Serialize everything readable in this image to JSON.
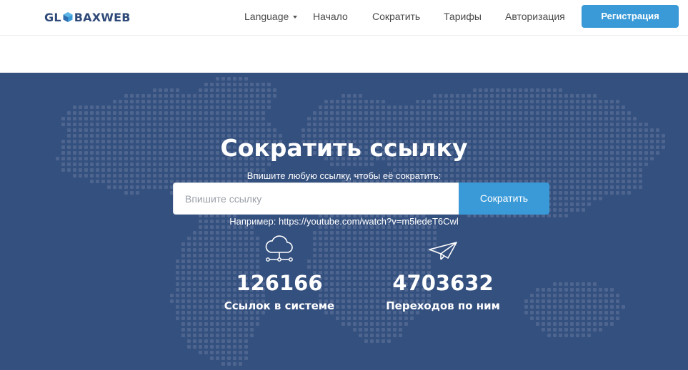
{
  "brand": {
    "name_left": "GL",
    "name_right": "BAXWEB"
  },
  "nav": {
    "language": "Language",
    "home": "Начало",
    "shorten": "Сократить",
    "pricing": "Тарифы",
    "login": "Авторизация",
    "register": "Регистрация"
  },
  "hero": {
    "title": "Сократить ссылку",
    "subtitle": "Впишите любую ссылку, чтобы её сократить:",
    "input_placeholder": "Впишите ссылку",
    "input_value": "",
    "button": "Сократить",
    "example": "Например: https://youtube.com/watch?v=m5ledeT6Cwl"
  },
  "stats": [
    {
      "icon": "cloud-network-icon",
      "value": "126166",
      "label": "Ссылок в системе"
    },
    {
      "icon": "paper-plane-icon",
      "value": "4703632",
      "label": "Переходов по ним"
    }
  ],
  "colors": {
    "brand_blue": "#3a9ad8",
    "hero_bg": "#34507f",
    "logo_text": "#2f4a78"
  }
}
